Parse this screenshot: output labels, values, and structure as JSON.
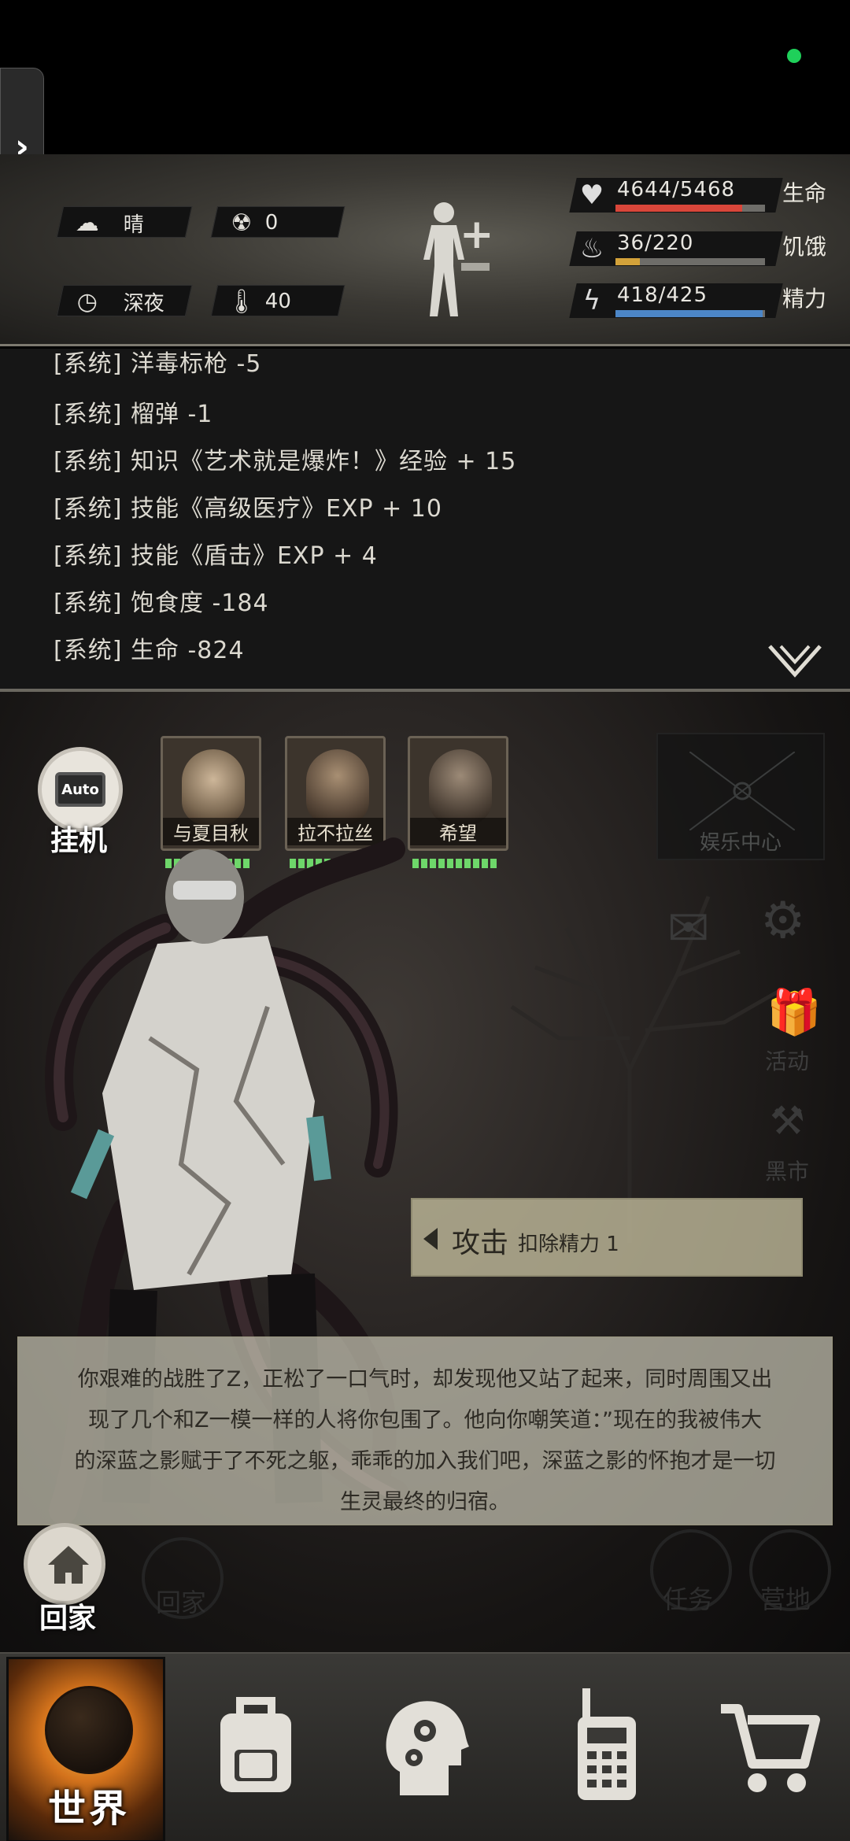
{
  "status": {
    "weather": {
      "icon": "cloud-sun-icon",
      "label": "晴"
    },
    "radiation": {
      "icon": "radiation-icon",
      "value": "0"
    },
    "time": {
      "icon": "clock-icon",
      "label": "深夜"
    },
    "temperature": {
      "icon": "thermometer-icon",
      "value": "40"
    },
    "stats": [
      {
        "name": "生命",
        "value": "4644/5468",
        "fraction": 0.849,
        "color": "#d9463a",
        "icon": "heart-icon"
      },
      {
        "name": "饥饿",
        "value": "36/220",
        "fraction": 0.164,
        "color": "#d3a23a",
        "icon": "stomach-icon"
      },
      {
        "name": "精力",
        "value": "418/425",
        "fraction": 0.983,
        "color": "#4c86c7",
        "icon": "energy-head-icon"
      }
    ]
  },
  "log": {
    "lines": [
      "[系统] 洋毒标枪 -5",
      "[系统] 榴弹 -1",
      "[系统] 知识《艺术就是爆炸！》经验 + 15",
      "[系统] 技能《高级医疗》EXP + 10",
      "[系统] 技能《盾击》EXP + 4",
      "[系统] 饱食度 -184",
      "[系统] 生命 -824"
    ]
  },
  "battle": {
    "auto": {
      "screen": "Auto",
      "label": "挂机"
    },
    "allies": [
      {
        "name": "与夏目秋",
        "hp_segments": 10
      },
      {
        "name": "拉不拉丝",
        "hp_segments": 5
      },
      {
        "name": "希望",
        "hp_segments": 10
      }
    ],
    "entertainment_center": "娱乐中心",
    "side_menu": [
      {
        "label": "活动",
        "icon": "gift-icon"
      },
      {
        "label": "黑市",
        "icon": "hammer-icon"
      }
    ],
    "attack": {
      "title": "攻击",
      "cost": "扣除精力 1"
    },
    "dialog": [
      "你艰难的战胜了Z，正松了一口气时，却发现他又站了起来，同时周围又出",
      "现了几个和Z一模一样的人将你包围了。他向你嘲笑道：”现在的我被伟大",
      "的深蓝之影赋于了不死之躯，乖乖的加入我们吧，深蓝之影的怀抱才是一切",
      "生灵最终的归宿。"
    ],
    "home": "回家",
    "ghost_labels": {
      "home": "回家",
      "task": "任务",
      "camp": "营地"
    }
  },
  "nav": {
    "items": [
      {
        "label": "世界",
        "icon": "globe-icon",
        "selected": true
      },
      {
        "label": "",
        "icon": "backpack-icon"
      },
      {
        "label": "",
        "icon": "head-gears-icon"
      },
      {
        "label": "",
        "icon": "walkie-talkie-icon"
      },
      {
        "label": "",
        "icon": "cart-icon"
      }
    ]
  },
  "colors": {
    "hp_green": "#6ed76a",
    "nav_glow": "#d4731c",
    "online_dot": "#1fd05a"
  }
}
